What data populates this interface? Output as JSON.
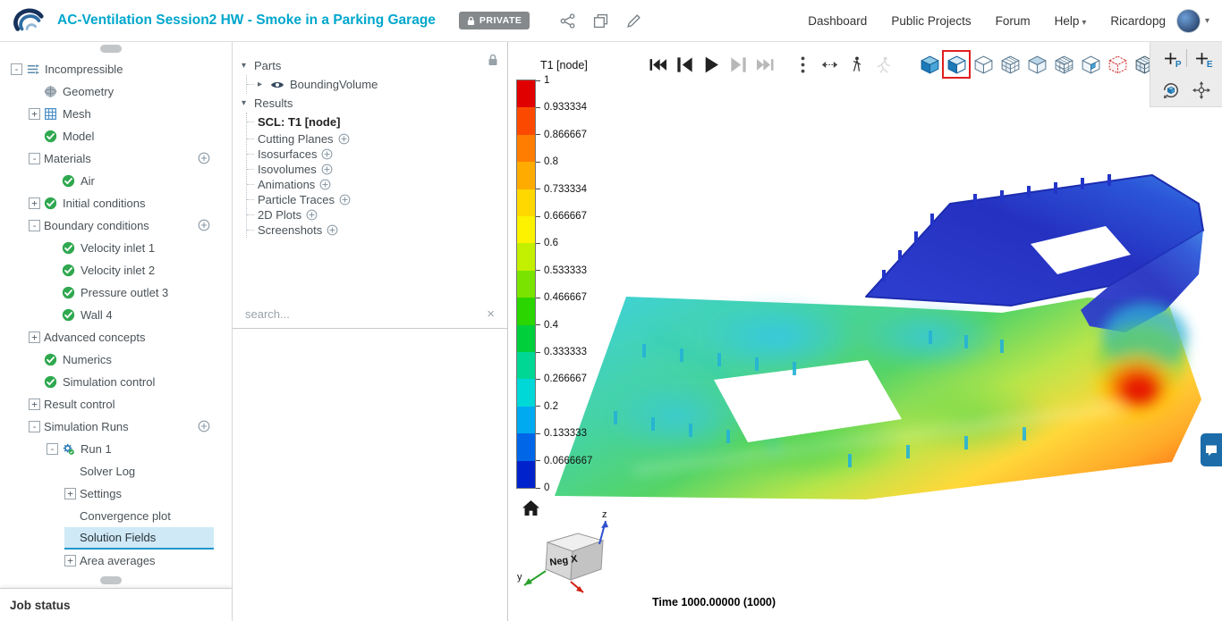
{
  "header": {
    "project_title": "AC-Ventilation Session2 HW - Smoke in a Parking Garage",
    "privacy_badge": "PRIVATE",
    "action_icons": [
      "share-icon",
      "duplicate-icon",
      "edit-icon"
    ],
    "nav_items": [
      {
        "label": "Dashboard"
      },
      {
        "label": "Public Projects"
      },
      {
        "label": "Forum"
      },
      {
        "label": "Help",
        "caret": true
      }
    ],
    "username": "Ricardopg"
  },
  "sidebar": {
    "job_status_label": "Job status",
    "tree": [
      {
        "label": "Incompressible",
        "indent": 0,
        "expander": "minus",
        "icon": "incompressible"
      },
      {
        "label": "Geometry",
        "indent": 1,
        "icon": "geometry"
      },
      {
        "label": "Mesh",
        "indent": 1,
        "expander": "plus",
        "icon": "mesh"
      },
      {
        "label": "Model",
        "indent": 1,
        "icon": "check"
      },
      {
        "label": "Materials",
        "indent": 1,
        "expander": "minus",
        "add_button": true
      },
      {
        "label": "Air",
        "indent": 2,
        "icon": "check"
      },
      {
        "label": "Initial conditions",
        "indent": 1,
        "expander": "plus",
        "icon": "check"
      },
      {
        "label": "Boundary conditions",
        "indent": 1,
        "expander": "minus",
        "add_button": true
      },
      {
        "label": "Velocity inlet 1",
        "indent": 2,
        "icon": "check"
      },
      {
        "label": "Velocity inlet 2",
        "indent": 2,
        "icon": "check"
      },
      {
        "label": "Pressure outlet 3",
        "indent": 2,
        "icon": "check"
      },
      {
        "label": "Wall 4",
        "indent": 2,
        "icon": "check"
      },
      {
        "label": "Advanced concepts",
        "indent": 1,
        "expander": "plus"
      },
      {
        "label": "Numerics",
        "indent": 1,
        "icon": "check"
      },
      {
        "label": "Simulation control",
        "indent": 1,
        "icon": "check"
      },
      {
        "label": "Result control",
        "indent": 1,
        "expander": "plus"
      },
      {
        "label": "Simulation Runs",
        "indent": 1,
        "expander": "minus",
        "add_button": true
      },
      {
        "label": "Run 1",
        "indent": 2,
        "expander": "minus",
        "icon": "gear-check"
      },
      {
        "label": "Solver Log",
        "indent": 3
      },
      {
        "label": "Settings",
        "indent": 3,
        "expander": "plus"
      },
      {
        "label": "Convergence plot",
        "indent": 3
      },
      {
        "label": "Solution Fields",
        "indent": 3,
        "selected": true
      },
      {
        "label": "Area averages",
        "indent": 3,
        "expander": "plus"
      }
    ]
  },
  "parts_panel": {
    "parts_group_label": "Parts",
    "bounding_volume_label": "BoundingVolume",
    "results_group_label": "Results",
    "scl_item_label": "SCL: T1 [node]",
    "addable_items": [
      "Cutting Planes",
      "Isosurfaces",
      "Isovolumes",
      "Animations",
      "Particle Traces",
      "2D Plots",
      "Screenshots"
    ],
    "search_placeholder": "search..."
  },
  "viewport": {
    "legend": {
      "title": "T1 [node]",
      "tick_labels": [
        "1",
        "0.933334",
        "0.866667",
        "0.8",
        "0.733334",
        "0.666667",
        "0.6",
        "0.533333",
        "0.466667",
        "0.4",
        "0.333333",
        "0.266667",
        "0.2",
        "0.133333",
        "0.0666667",
        "0"
      ],
      "band_colors": [
        "#e10000",
        "#fb4a00",
        "#ff7d00",
        "#ffab00",
        "#ffd800",
        "#fdf200",
        "#c3ef00",
        "#7ae300",
        "#2ad500",
        "#00cf3c",
        "#00d795",
        "#00d8d8",
        "#00aaf0",
        "#0066e8",
        "#0022cc"
      ]
    },
    "toolbar": {
      "playback": [
        {
          "name": "skip-to-first-icon"
        },
        {
          "name": "step-back-icon"
        },
        {
          "name": "play-icon"
        },
        {
          "name": "step-forward-icon",
          "disabled": true
        },
        {
          "name": "skip-to-last-icon",
          "disabled": true
        }
      ],
      "tools": [
        {
          "name": "more-options-icon"
        },
        {
          "name": "fit-width-icon"
        },
        {
          "name": "walkthrough-icon"
        },
        {
          "name": "flythrough-icon",
          "disabled": true
        }
      ],
      "view_modes": [
        {
          "name": "perspective-view-icon"
        },
        {
          "name": "orthogonal-view-icon",
          "highlighted": true
        },
        {
          "name": "cube-outline-view-icon"
        },
        {
          "name": "cube-grid-view-icon"
        },
        {
          "name": "cube-section-view-icon"
        },
        {
          "name": "cube-mesh-view-icon"
        },
        {
          "name": "cube-corner-view-icon"
        },
        {
          "name": "cube-faces-select-icon"
        },
        {
          "name": "cube-table-view-icon"
        }
      ],
      "probes": [
        {
          "name": "add-point-probe-icon",
          "letter": "P"
        },
        {
          "name": "add-element-probe-icon",
          "letter": "E"
        }
      ],
      "view_tools": [
        {
          "name": "rotate-view-icon"
        },
        {
          "name": "center-view-icon"
        }
      ]
    },
    "time_label": "Time 1000.00000 (1000)",
    "orientation": {
      "cube_face_label": "Neg X",
      "axis_z": "z",
      "axis_y": "y"
    }
  }
}
